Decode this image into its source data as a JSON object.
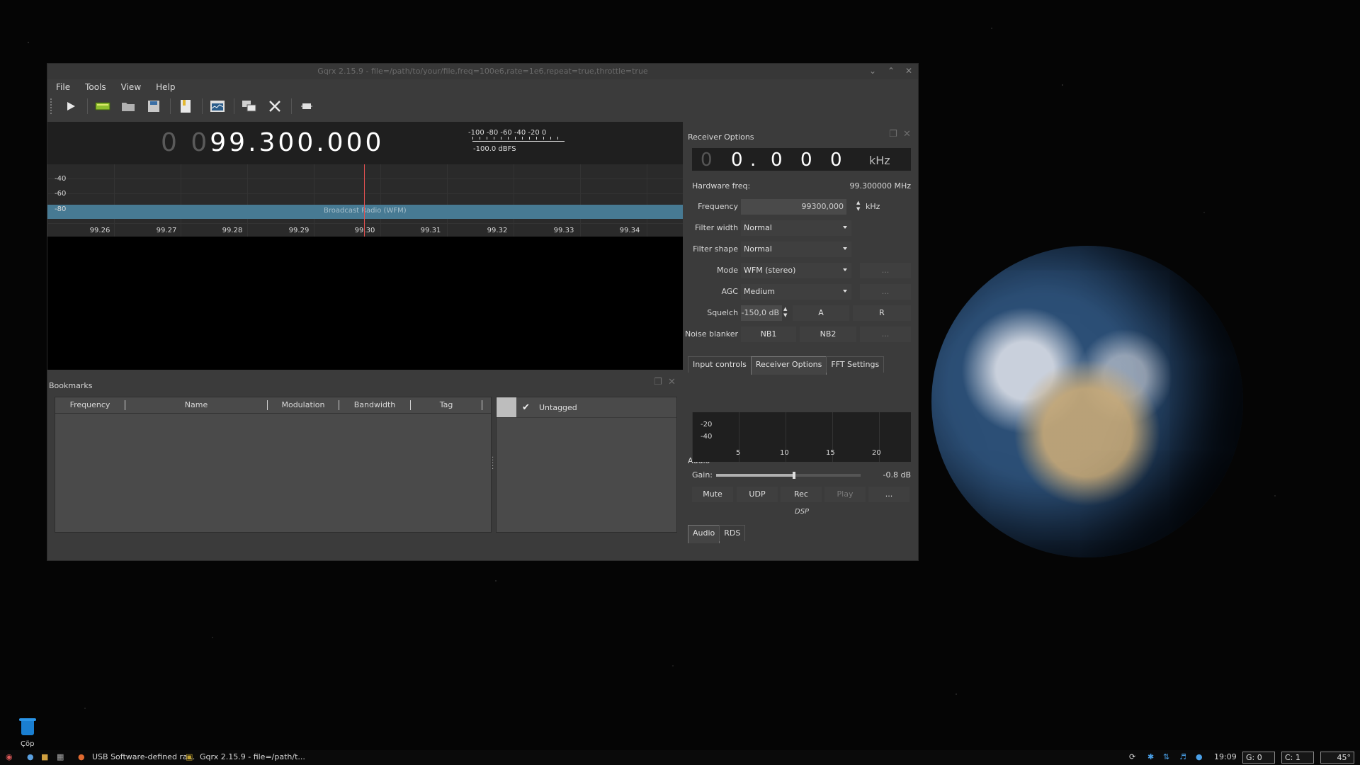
{
  "window": {
    "title": "Gqrx 2.15.9 - file=/path/to/your/file,freq=100e6,rate=1e6,repeat=true,throttle=true"
  },
  "menu": [
    "File",
    "Tools",
    "View",
    "Help"
  ],
  "frequency_display": {
    "dim": "0 0",
    "main": "99.300.000"
  },
  "meter": {
    "scale": "-100 -80 -60 -40 -20 0",
    "level": "-100.0 dBFS"
  },
  "spectrum": {
    "db_labels": [
      "-40",
      "-60",
      "-80"
    ],
    "band_label": "Broadcast Radio (WFM)",
    "freq_labels": [
      "99.26",
      "99.27",
      "99.28",
      "99.29",
      "99.30",
      "99.31",
      "99.32",
      "99.33",
      "99.34"
    ]
  },
  "bookmarks": {
    "title": "Bookmarks",
    "columns": [
      "Frequency",
      "Name",
      "Modulation",
      "Bandwidth",
      "Tag"
    ],
    "tags": [
      {
        "name": "Untagged",
        "checked": true,
        "color": "#bdbdbd"
      }
    ]
  },
  "receiver": {
    "title": "Receiver Options",
    "offset": {
      "dim": "0",
      "digits": [
        "0",
        ".",
        "0",
        "0",
        "0"
      ],
      "unit": "kHz"
    },
    "hw_label": "Hardware freq:",
    "hw_value": "99.300000 MHz",
    "frequency": {
      "label": "Frequency",
      "value": "99300,000",
      "unit": "kHz"
    },
    "filter_width": {
      "label": "Filter width",
      "value": "Normal"
    },
    "filter_shape": {
      "label": "Filter shape",
      "value": "Normal"
    },
    "mode": {
      "label": "Mode",
      "value": "WFM (stereo)",
      "more": "..."
    },
    "agc": {
      "label": "AGC",
      "value": "Medium",
      "more": "..."
    },
    "squelch": {
      "label": "Squelch",
      "value": "-150,0 dB",
      "a": "A",
      "r": "R"
    },
    "noise_blanker": {
      "label": "Noise blanker",
      "nb1": "NB1",
      "nb2": "NB2",
      "more": "..."
    }
  },
  "dock_tabs": [
    "Input controls",
    "Receiver Options",
    "FFT Settings"
  ],
  "audio": {
    "title": "Audio",
    "db_labels": [
      "-20",
      "-40"
    ],
    "freq_labels": [
      "5",
      "10",
      "15",
      "20"
    ],
    "gain_label": "Gain:",
    "gain_value": "-0.8 dB",
    "gain_level": 0.54,
    "buttons": [
      "Mute",
      "UDP",
      "Rec",
      "Play",
      "..."
    ],
    "dsp": "DSP",
    "tabs": [
      "Audio",
      "RDS"
    ]
  },
  "desktop": {
    "trash_label": "Çöp"
  },
  "taskbar": {
    "apps": [
      "USB Software-defined ra...",
      "Gqrx 2.15.9 - file=/path/t..."
    ],
    "clock": "19:09",
    "boxes": [
      "G:  0",
      "C:  1",
      "45°"
    ]
  }
}
